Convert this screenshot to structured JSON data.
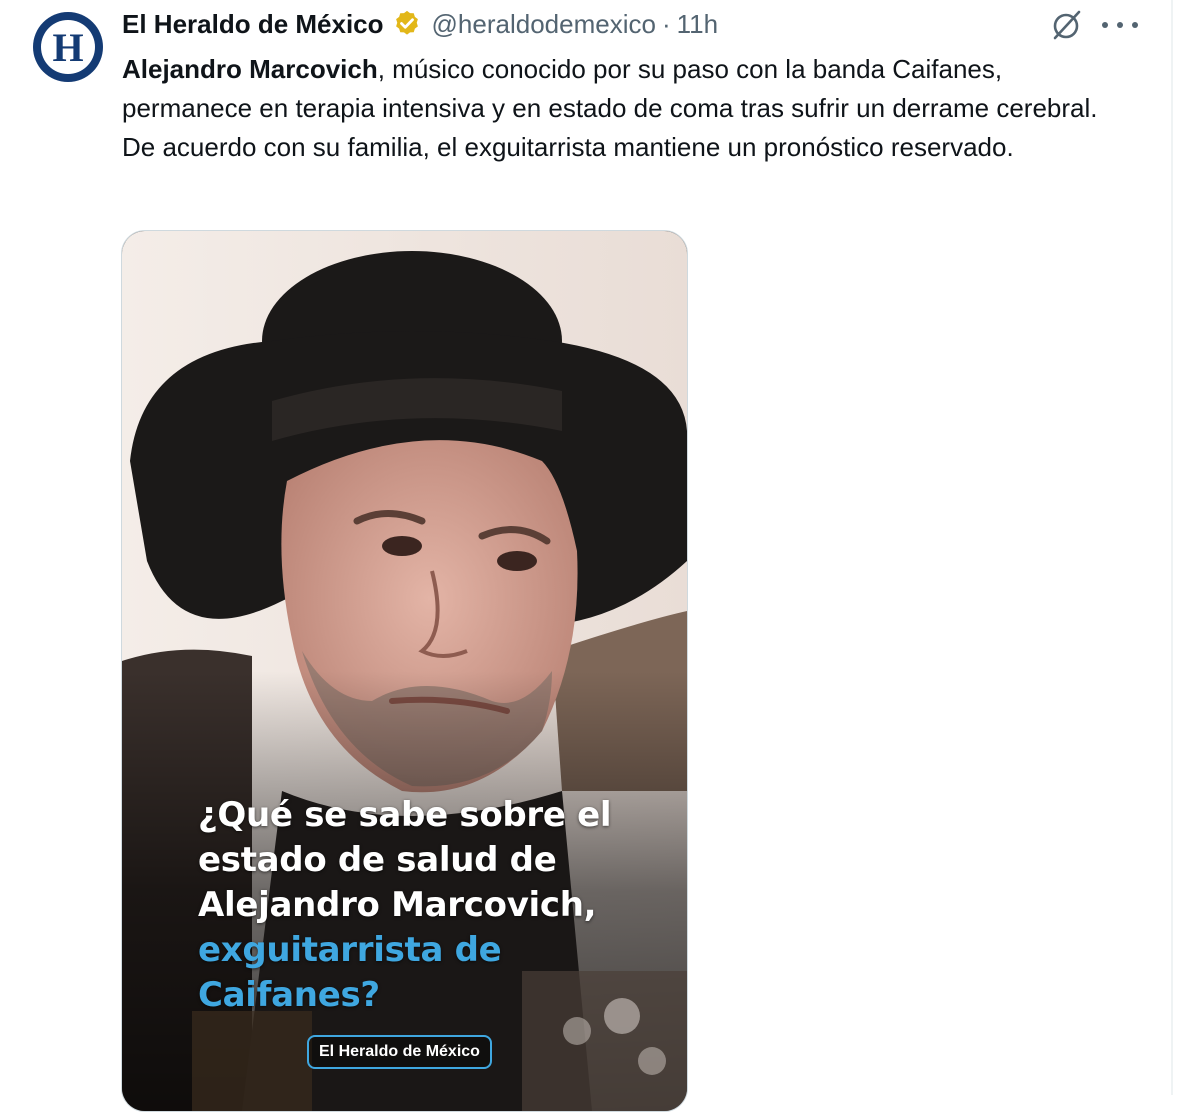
{
  "tweet": {
    "author_name": "El Heraldo de México",
    "handle": "@heraldodemexico",
    "separator": "·",
    "time": "11h",
    "avatar_letter": "H",
    "text_bold": "Alejandro Marcovich",
    "text_rest": ", músico conocido por su paso con la banda Caifanes, permanece en terapia intensiva y en estado de coma tras sufrir un derrame cerebral. De acuerdo con su familia, el exguitarrista mantiene un pronóstico reservado.",
    "icons": {
      "verified": "verified-gold-badge-icon",
      "grok": "grok-icon",
      "more": "more-options-icon"
    },
    "colors": {
      "brand": "#143b74",
      "verified": "#e2b719",
      "accent": "#3fa7e0",
      "secondary_text": "#536471"
    }
  },
  "media": {
    "overlay_line1": "¿Qué se sabe sobre el",
    "overlay_line2": "estado de salud de",
    "overlay_line3": "Alejandro Marcovich,",
    "overlay_line4": "exguitarrista de Caifanes?",
    "watermark": "El Heraldo de México"
  }
}
